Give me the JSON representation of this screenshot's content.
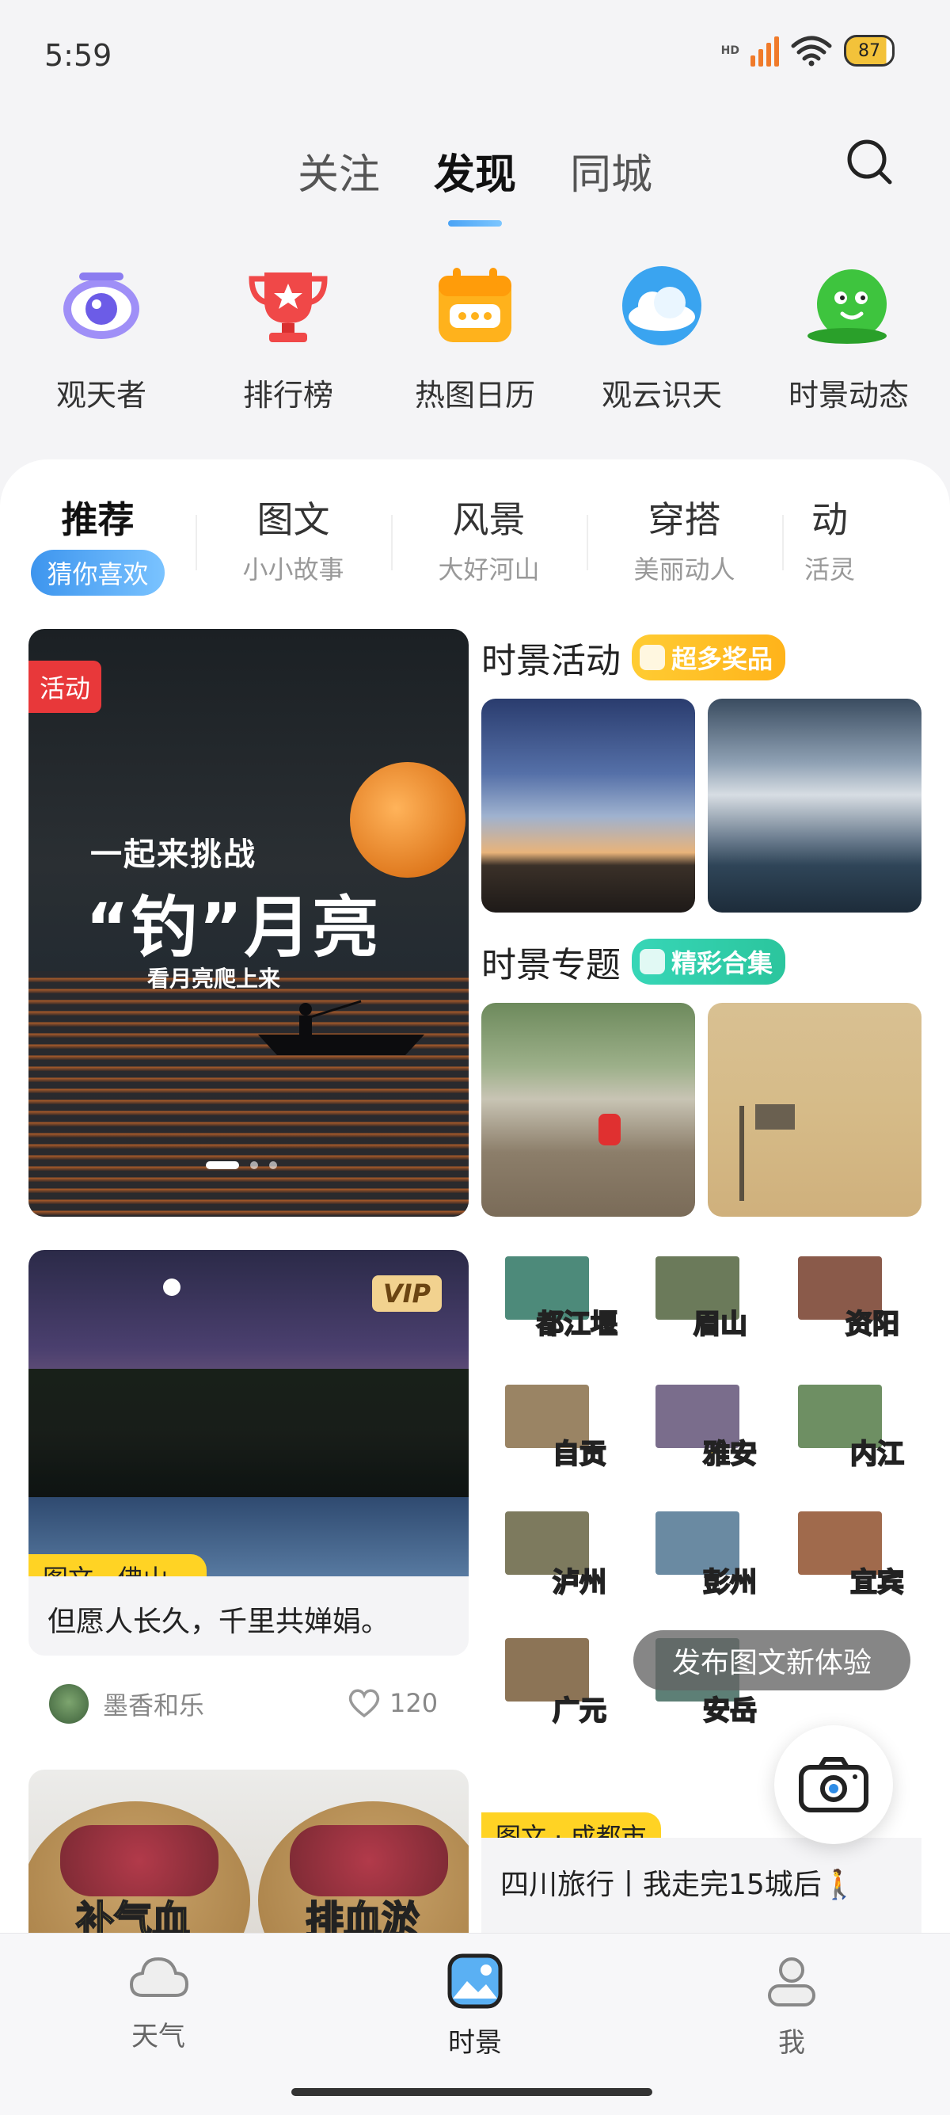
{
  "status": {
    "time": "5:59",
    "battery": "87",
    "network": "HD"
  },
  "top_tabs": [
    {
      "label": "关注"
    },
    {
      "label": "发现"
    },
    {
      "label": "同城"
    }
  ],
  "features": [
    {
      "label": "观天者",
      "icon": "eye-icon",
      "color": "#7b6cf2"
    },
    {
      "label": "排行榜",
      "icon": "trophy-icon",
      "color": "#ee3b3b"
    },
    {
      "label": "热图日历",
      "icon": "calendar-icon",
      "color": "#ffae1a"
    },
    {
      "label": "观云识天",
      "icon": "cloud-icon",
      "color": "#3aa4f0"
    },
    {
      "label": "时景动态",
      "icon": "smiley-icon",
      "color": "#3ec43e"
    }
  ],
  "categories": [
    {
      "title": "推荐",
      "sub": "猜你喜欢"
    },
    {
      "title": "图文",
      "sub": "小小故事"
    },
    {
      "title": "风景",
      "sub": "大好河山"
    },
    {
      "title": "穿搭",
      "sub": "美丽动人"
    },
    {
      "title": "动",
      "sub": "活灵"
    }
  ],
  "banner": {
    "badge": "活动",
    "line1": "一起来挑战",
    "line2": "“钓”月亮",
    "line3": "看月亮爬上来"
  },
  "sections": {
    "activity": {
      "title": "时景活动",
      "pill": "超多奖品"
    },
    "topics": {
      "title": "时景专题",
      "pill": "精彩合集"
    }
  },
  "feed": {
    "card1": {
      "badge": "VIP",
      "tag": "图文 · 佛山...",
      "caption": "但愿人长久，千里共婵娟。",
      "author": "墨香和乐",
      "likes": "120"
    },
    "card2": {
      "tag": "图文 · 成都市",
      "caption": "四川旅行丨我走完15城后🚶",
      "collage_labels": [
        "都江堰",
        "眉山",
        "资阳",
        "自贡",
        "雅安",
        "内江",
        "泸州",
        "彭州",
        "宜宾",
        "广元",
        "安岳"
      ]
    },
    "card3": {
      "labels": [
        "补气血",
        "排血淤"
      ]
    }
  },
  "publish_tip": "发布图文新体验",
  "bottom_nav": [
    {
      "label": "天气",
      "icon": "cloud-outline-icon"
    },
    {
      "label": "时景",
      "icon": "photo-icon"
    },
    {
      "label": "我",
      "icon": "person-icon"
    }
  ]
}
